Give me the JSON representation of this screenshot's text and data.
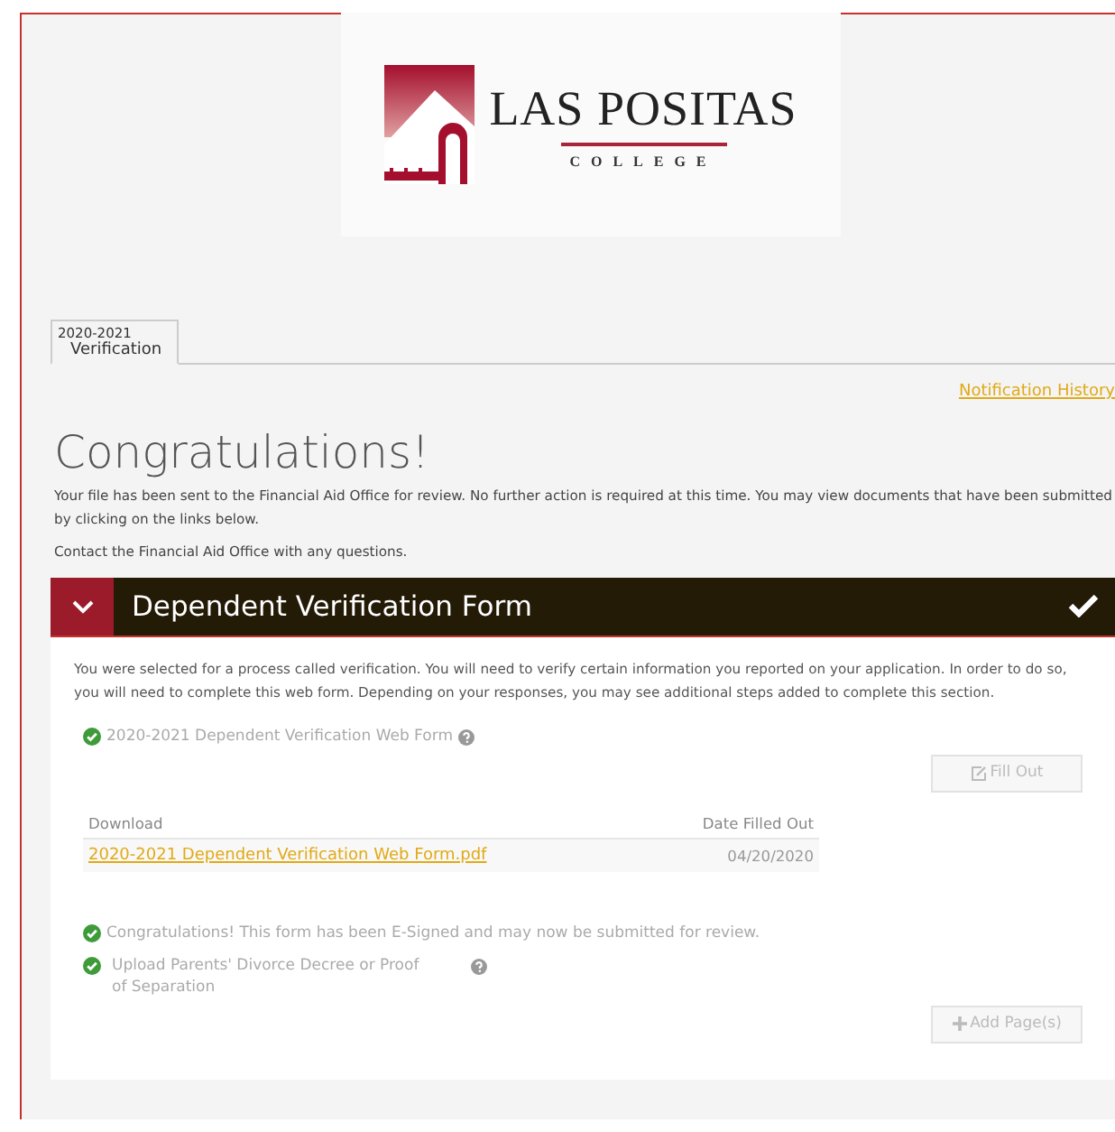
{
  "logo": {
    "name": "LAS POSITAS",
    "subtitle": "COLLEGE"
  },
  "tabs": [
    {
      "year": "2020-2021",
      "label": "Verification",
      "selected": true
    }
  ],
  "notification_link": "Notification History",
  "heading": "Congratulations!",
  "intro": [
    "Your file has been sent to the Financial Aid Office for review. No further action is required at this time. You may view documents that have been submitted by clicking on the links below.",
    "Contact the Financial Aid Office with any questions."
  ],
  "panel": {
    "title": "Dependent Verification Form",
    "expanded": true,
    "completed": true,
    "description": "You were selected for a process called verification. You will need to verify certain information you reported on your application. In order to do so, you will need to complete this web form. Depending on your responses, you may see additional steps added to complete this section.",
    "steps": [
      {
        "kind": "form",
        "label": "2020-2021 Dependent Verification Web Form",
        "completed": true,
        "help": true,
        "button": {
          "label": "Fill Out",
          "disabled": true
        },
        "table": {
          "columns": [
            "Download",
            "Date Filled Out"
          ],
          "rows": [
            {
              "file": "2020-2021 Dependent Verification Web Form.pdf",
              "date": "04/20/2020"
            }
          ]
        }
      },
      {
        "kind": "note",
        "label": "Congratulations! This form has been E-Signed and may now be submitted for review.",
        "completed": true
      },
      {
        "kind": "upload",
        "label": "Upload Parents' Divorce Decree or Proof of Separation",
        "completed": true,
        "help": true,
        "button": {
          "label": "Add Page(s)",
          "disabled": true
        }
      }
    ]
  }
}
